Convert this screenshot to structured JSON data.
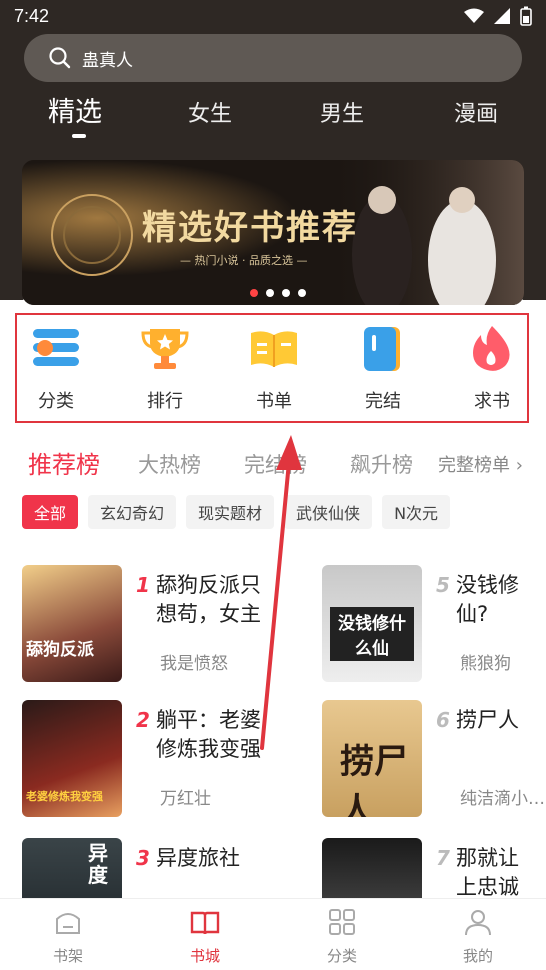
{
  "status_bar": {
    "time": "7:42"
  },
  "search": {
    "placeholder": "蛊真人"
  },
  "top_tabs": [
    {
      "label": "精选",
      "active": true
    },
    {
      "label": "女生"
    },
    {
      "label": "男生"
    },
    {
      "label": "漫画"
    }
  ],
  "banner": {
    "title": "精选好书推荐",
    "subtitle": "— 热门小说 · 品质之选 —",
    "dots": 4,
    "active_dot": 0
  },
  "quick_actions": [
    {
      "label": "分类",
      "icon": "list-icon"
    },
    {
      "label": "排行",
      "icon": "trophy-icon"
    },
    {
      "label": "书单",
      "icon": "book-icon"
    },
    {
      "label": "完结",
      "icon": "bookmark-icon"
    },
    {
      "label": "求书",
      "icon": "flame-icon"
    }
  ],
  "rank_tabs": [
    {
      "label": "推荐榜",
      "active": true
    },
    {
      "label": "大热榜"
    },
    {
      "label": "完结榜"
    },
    {
      "label": "飙升榜"
    },
    {
      "label": "完整榜单 ›"
    }
  ],
  "chips": [
    {
      "label": "全部",
      "active": true
    },
    {
      "label": "玄幻奇幻"
    },
    {
      "label": "现实题材"
    },
    {
      "label": "武侠仙侠"
    },
    {
      "label": "N次元"
    }
  ],
  "books": [
    {
      "rank": "1",
      "title": "舔狗反派只想苟，女主不…",
      "author": "我是愤怒",
      "cover_text": "舔狗反派"
    },
    {
      "rank": "5",
      "title": "没钱修仙?",
      "author": "熊狼狗",
      "cover_text": "没钱修什么仙"
    },
    {
      "rank": "2",
      "title": "躺平：老婆修炼我变强",
      "author": "万红壮",
      "cover_text": "老婆修炼我变强"
    },
    {
      "rank": "6",
      "title": "捞尸人",
      "author": "纯洁滴小…",
      "cover_text": "捞尸人"
    },
    {
      "rank": "3",
      "title": "异度旅社",
      "author": "",
      "cover_text": "异度"
    },
    {
      "rank": "7",
      "title": "那就让上忠诚",
      "author": "",
      "cover_text": ""
    }
  ],
  "bottom_nav": [
    {
      "label": "书架",
      "icon": "shelf-icon"
    },
    {
      "label": "书城",
      "icon": "open-book-icon",
      "active": true
    },
    {
      "label": "分类",
      "icon": "grid-icon"
    },
    {
      "label": "我的",
      "icon": "user-icon"
    }
  ],
  "colors": {
    "accent": "#f0344a",
    "header_bg": "#2e2824"
  }
}
